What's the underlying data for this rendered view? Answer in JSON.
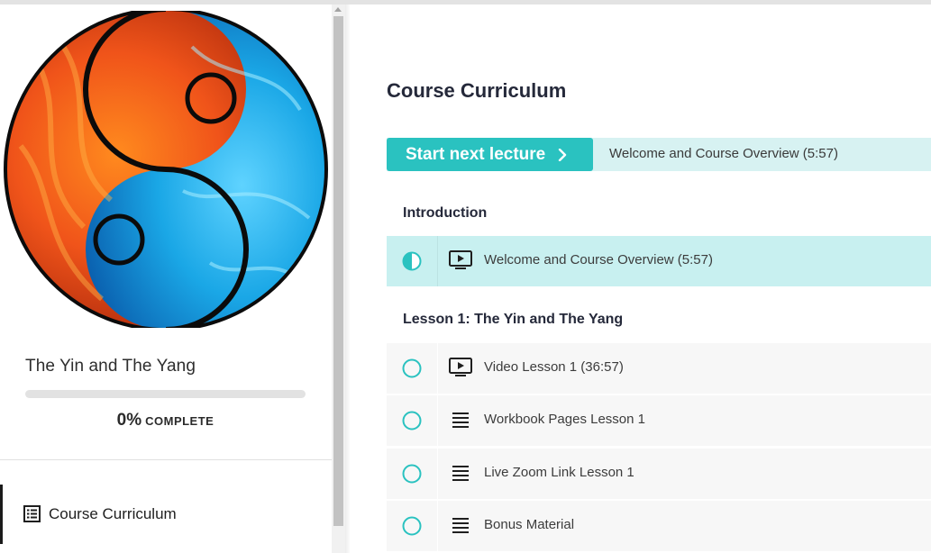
{
  "course": {
    "title": "The Yin and The Yang",
    "progress_percent": 0,
    "progress_pct_text": "0%",
    "progress_word": "COMPLETE"
  },
  "sidebar": {
    "items": [
      {
        "label": "Course Curriculum",
        "icon": "curriculum-list-icon",
        "active": true
      }
    ]
  },
  "main": {
    "title": "Course Curriculum",
    "next_button_label": "Start next lecture",
    "next_lecture_name": "Welcome and Course Overview (5:57)",
    "sections": [
      {
        "title": "Introduction",
        "lectures": [
          {
            "label": "Welcome and Course Overview (5:57)",
            "type": "video",
            "status": "in-progress"
          }
        ]
      },
      {
        "title": "Lesson 1: The Yin and The Yang",
        "lectures": [
          {
            "label": "Video Lesson 1 (36:57)",
            "type": "video",
            "status": "not-started"
          },
          {
            "label": "Workbook Pages Lesson 1",
            "type": "text",
            "status": "not-started"
          },
          {
            "label": "Live Zoom Link Lesson 1",
            "type": "text",
            "status": "not-started"
          },
          {
            "label": "Bonus Material",
            "type": "text",
            "status": "not-started"
          }
        ]
      }
    ]
  },
  "colors": {
    "accent": "#2ac2c0",
    "current_row": "#c8f0f0",
    "next_bar": "#d7f2f2",
    "fire": "#e8521b",
    "water": "#1aa7e6"
  }
}
